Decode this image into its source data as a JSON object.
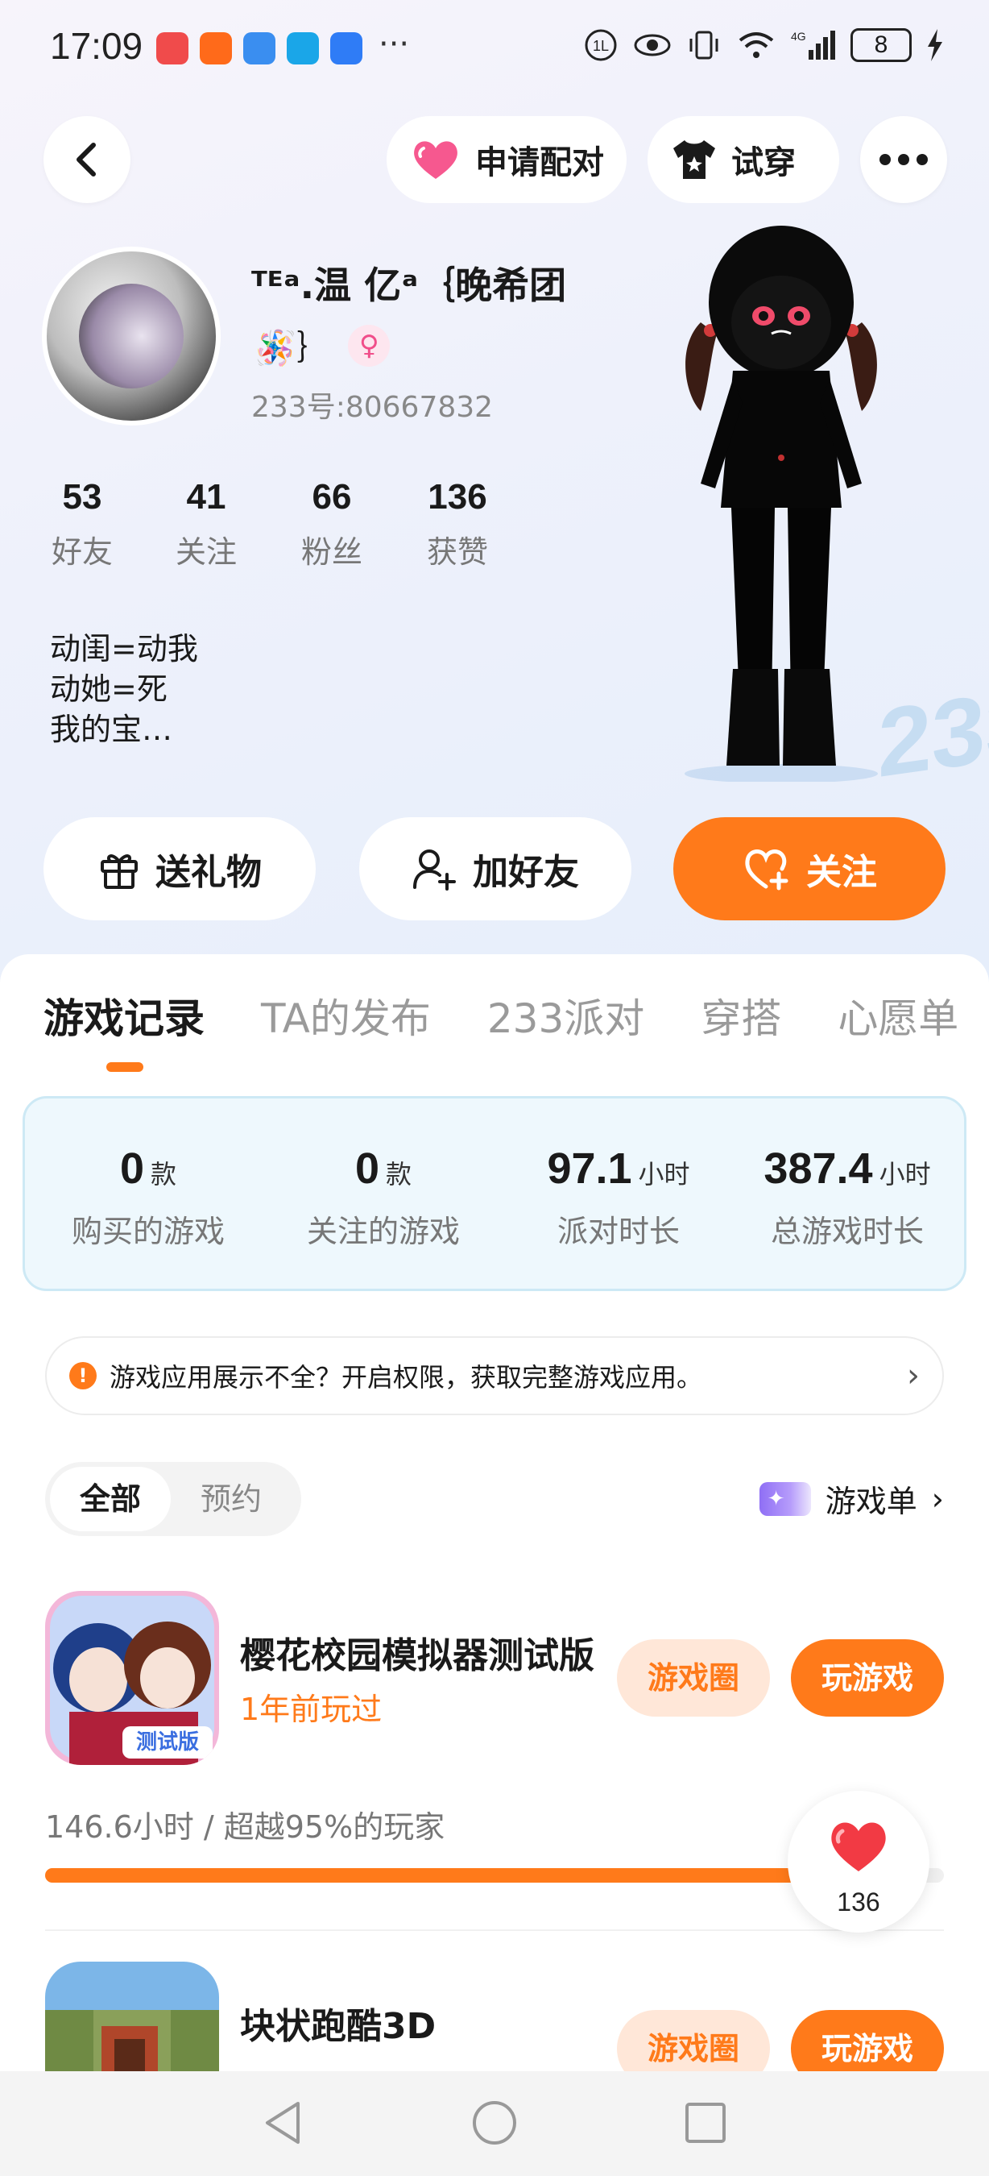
{
  "status_bar": {
    "time": "17:09",
    "ellipsis": "···",
    "battery": "8",
    "app_icon_colors": [
      "#f04b4b",
      "#ff6a1a",
      "#3a8ef0",
      "#1aa6e8",
      "#2f7cf6"
    ]
  },
  "header": {
    "match_label": "申请配对",
    "tryon_label": "试穿",
    "more_label": "•••"
  },
  "profile": {
    "nickname": "ᵀᴱᵃ.温  亿ᵃ｛晚希团",
    "nickname_line2": "🪅｝",
    "gender_symbol": "♀",
    "uid": "233号:80667832",
    "stats": [
      {
        "num": "53",
        "label": "好友"
      },
      {
        "num": "41",
        "label": "关注"
      },
      {
        "num": "66",
        "label": "粉丝"
      },
      {
        "num": "136",
        "label": "获赞"
      }
    ],
    "bio_lines": [
      "动闺=动我",
      "动她=死",
      "我的宝…"
    ]
  },
  "actions": {
    "gift_label": "送礼物",
    "friend_label": "加好友",
    "follow_label": "关注"
  },
  "tabs": [
    "游戏记录",
    "TA的发布",
    "233派对",
    "穿搭",
    "心愿单"
  ],
  "game_stats": [
    {
      "value": "0",
      "unit": "款",
      "label": "购买的游戏"
    },
    {
      "value": "0",
      "unit": "款",
      "label": "关注的游戏"
    },
    {
      "value": "97.1",
      "unit": "小时",
      "label": "派对时长"
    },
    {
      "value": "387.4",
      "unit": "小时",
      "label": "总游戏时长"
    }
  ],
  "notice": {
    "icon": "!",
    "text": "游戏应用展示不全？开启权限，获取完整游戏应用。",
    "chevron": "›"
  },
  "filter": {
    "all": "全部",
    "reserved": "预约",
    "gamelist_label": "游戏单",
    "gamelist_chevron": "›"
  },
  "games": [
    {
      "title": "樱花校园模拟器测试版",
      "subtitle": "1年前玩过",
      "circle_label": "游戏圈",
      "play_label": "玩游戏",
      "playtime": "146.6小时 / 超越95%的玩家",
      "progress": 0.95
    },
    {
      "title": "块状跑酷3D",
      "subtitle": "",
      "circle_label": "游戏圈",
      "play_label": "玩游戏"
    }
  ],
  "like_float": {
    "count": "136"
  },
  "colors": {
    "accent": "#ff7a1a",
    "accent_light": "#ffe7d8",
    "pink": "#f04e8a"
  }
}
